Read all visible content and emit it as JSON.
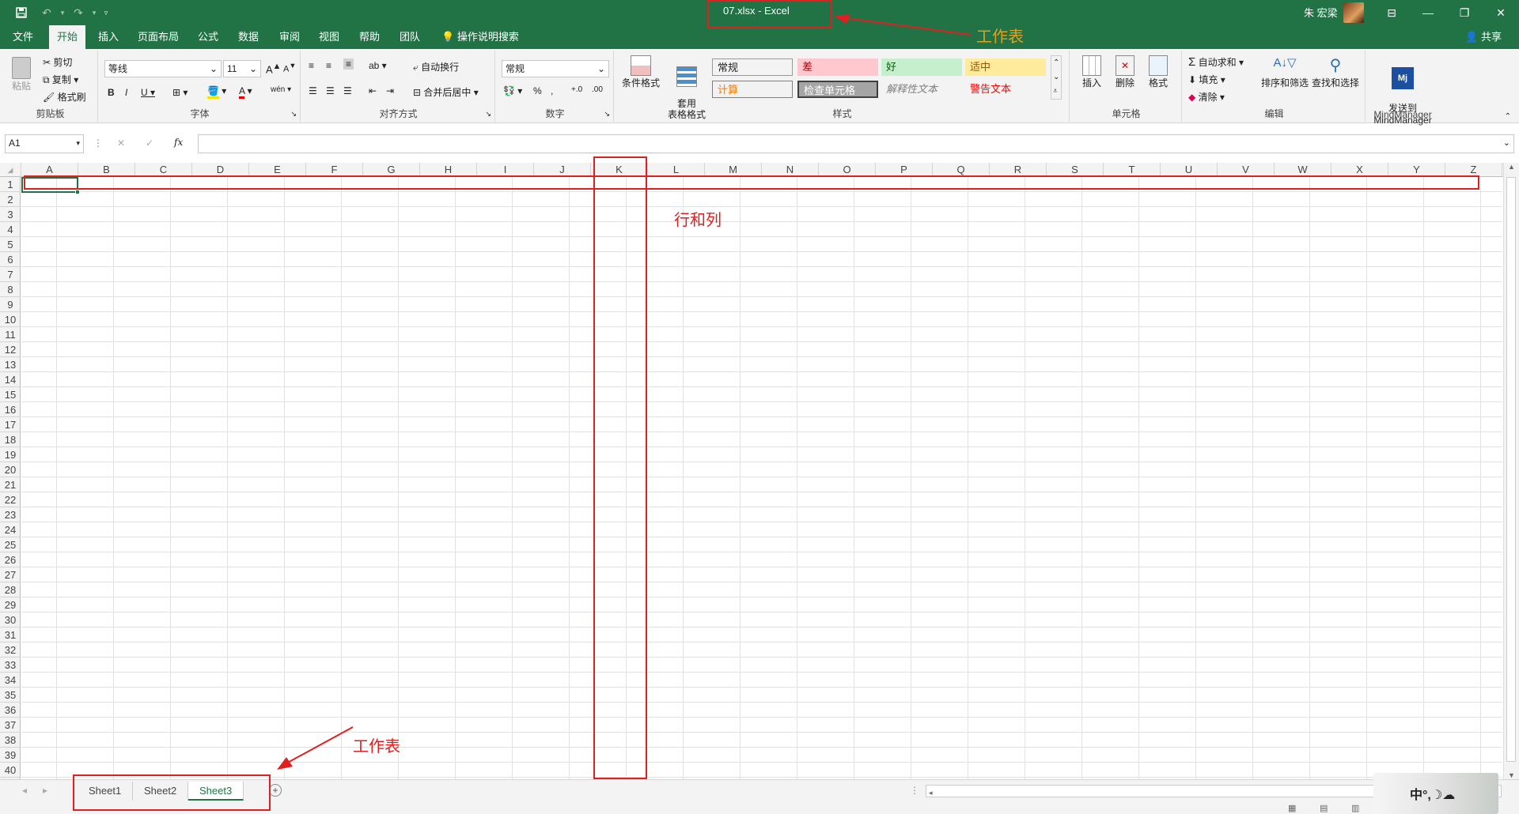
{
  "window": {
    "title": "07.xlsx  -  Excel",
    "user": "朱 宏梁"
  },
  "qat": {
    "save_icon": "save-icon",
    "undo_icon": "undo-icon",
    "redo_icon": "redo-icon",
    "customize_icon": "customize-icon"
  },
  "tabs": [
    "文件",
    "开始",
    "插入",
    "页面布局",
    "公式",
    "数据",
    "审阅",
    "视图",
    "帮助",
    "团队"
  ],
  "tell_me": "操作说明搜索",
  "share": "共享",
  "ribbon": {
    "clipboard": {
      "paste": "粘贴",
      "cut": "剪切",
      "copy": "复制",
      "format_painter": "格式刷",
      "label": "剪贴板"
    },
    "font": {
      "name": "等线",
      "size": "11",
      "label": "字体"
    },
    "alignment": {
      "wrap": "自动换行",
      "merge": "合并后居中",
      "label": "对齐方式"
    },
    "number": {
      "format": "常规",
      "label": "数字"
    },
    "styles": {
      "cond": "条件格式",
      "table": "套用\n表格格式",
      "label": "样式",
      "cells": [
        {
          "text": "常规",
          "bg": "#ffffff",
          "fg": "#000000"
        },
        {
          "text": "差",
          "bg": "#ffc7ce",
          "fg": "#9c0006"
        },
        {
          "text": "好",
          "bg": "#c6efce",
          "fg": "#006100"
        },
        {
          "text": "适中",
          "bg": "#ffeb9c",
          "fg": "#9c5700"
        },
        {
          "text": "计算",
          "bg": "#f2f2f2",
          "fg": "#fa7d00"
        },
        {
          "text": "检查单元格",
          "bg": "#a5a5a5",
          "fg": "#ffffff"
        },
        {
          "text": "解释性文本",
          "bg": "#ffffff",
          "fg": "#7f7f7f"
        },
        {
          "text": "警告文本",
          "bg": "#ffffff",
          "fg": "#ff0000"
        }
      ]
    },
    "cells": {
      "insert": "插入",
      "delete": "删除",
      "format": "格式",
      "label": "单元格"
    },
    "editing": {
      "autosum": "自动求和",
      "fill": "填充",
      "clear": "清除",
      "sort": "排序和筛选",
      "find": "查找和选择",
      "label": "编辑"
    },
    "mindmanager": {
      "send": "发送到\nMindManager",
      "label": "MindManager"
    }
  },
  "formula_bar": {
    "name_box": "A1",
    "fx": "fx",
    "cancel": "✕",
    "enter": "✓"
  },
  "columns": [
    "A",
    "B",
    "C",
    "D",
    "E",
    "F",
    "G",
    "H",
    "I",
    "J",
    "K",
    "L",
    "M",
    "N",
    "O",
    "P",
    "Q",
    "R",
    "S",
    "T",
    "U",
    "V",
    "W",
    "X",
    "Y",
    "Z"
  ],
  "rows": [
    "1",
    "2",
    "3",
    "4",
    "5",
    "6",
    "7",
    "8",
    "9",
    "10",
    "11",
    "12",
    "13",
    "14",
    "15",
    "16",
    "17",
    "18",
    "19",
    "20",
    "21",
    "22",
    "23",
    "24",
    "25",
    "26",
    "27",
    "28",
    "29",
    "30",
    "31",
    "32",
    "33",
    "34",
    "35",
    "36",
    "37",
    "38",
    "39",
    "40"
  ],
  "sheets": [
    "Sheet1",
    "Sheet2",
    "Sheet3"
  ],
  "active_sheet": "Sheet3",
  "annotations": {
    "top": "工作表",
    "middle": "行和列",
    "bottom": "工作表"
  },
  "accent": "#217346",
  "annotation_color": "#e02020"
}
